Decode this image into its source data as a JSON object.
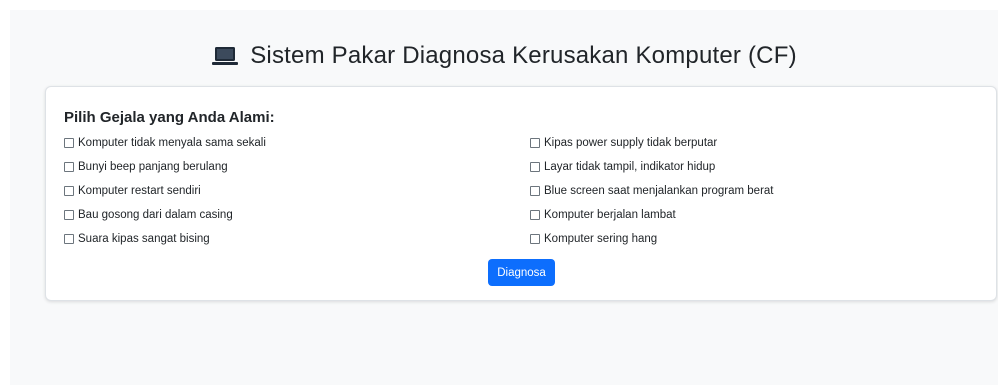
{
  "header": {
    "icon": "laptop-icon",
    "title": "Sistem Pakar Diagnosa Kerusakan Komputer (CF)"
  },
  "form": {
    "heading": "Pilih Gejala yang Anda Alami:",
    "left_options": [
      {
        "label": "Komputer tidak menyala sama sekali",
        "checked": false
      },
      {
        "label": "Bunyi beep panjang berulang",
        "checked": false
      },
      {
        "label": "Komputer restart sendiri",
        "checked": false
      },
      {
        "label": "Bau gosong dari dalam casing",
        "checked": false
      },
      {
        "label": "Suara kipas sangat bising",
        "checked": false
      }
    ],
    "right_options": [
      {
        "label": "Kipas power supply tidak berputar",
        "checked": false
      },
      {
        "label": "Layar tidak tampil, indikator hidup",
        "checked": false
      },
      {
        "label": "Blue screen saat menjalankan program berat",
        "checked": false
      },
      {
        "label": "Komputer berjalan lambat",
        "checked": false
      },
      {
        "label": "Komputer sering hang",
        "checked": false
      }
    ],
    "submit_label": "Diagnosa"
  },
  "colors": {
    "page_background": "#f8f9fa",
    "button": "#0d6efd",
    "text": "#212529"
  }
}
